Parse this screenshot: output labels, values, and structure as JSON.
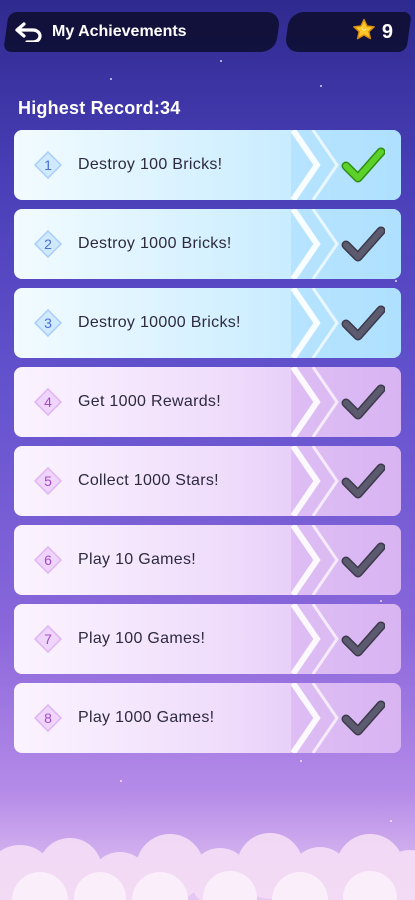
{
  "header": {
    "title": "My Achievements",
    "back_icon": "back-arrow-icon",
    "star_icon": "star-icon",
    "star_count": "9"
  },
  "highest_record": "Highest Record:34",
  "colors": {
    "blue_card": "#cfeeff",
    "purple_card": "#eeddfb",
    "check_complete": "#5bd12a",
    "check_pending": "#5c5a6e",
    "header_bg": "#0c0e30"
  },
  "achievements": [
    {
      "num": "1",
      "label": "Destroy 100 Bricks!",
      "completed": true,
      "theme": "blue"
    },
    {
      "num": "2",
      "label": "Destroy 1000 Bricks!",
      "completed": false,
      "theme": "blue"
    },
    {
      "num": "3",
      "label": "Destroy 10000 Bricks!",
      "completed": false,
      "theme": "blue"
    },
    {
      "num": "4",
      "label": "Get 1000 Rewards!",
      "completed": false,
      "theme": "purple"
    },
    {
      "num": "5",
      "label": "Collect 1000 Stars!",
      "completed": false,
      "theme": "purple"
    },
    {
      "num": "6",
      "label": "Play 10 Games!",
      "completed": false,
      "theme": "purple"
    },
    {
      "num": "7",
      "label": "Play 100 Games!",
      "completed": false,
      "theme": "purple"
    },
    {
      "num": "8",
      "label": "Play 1000 Games!",
      "completed": false,
      "theme": "purple"
    }
  ]
}
